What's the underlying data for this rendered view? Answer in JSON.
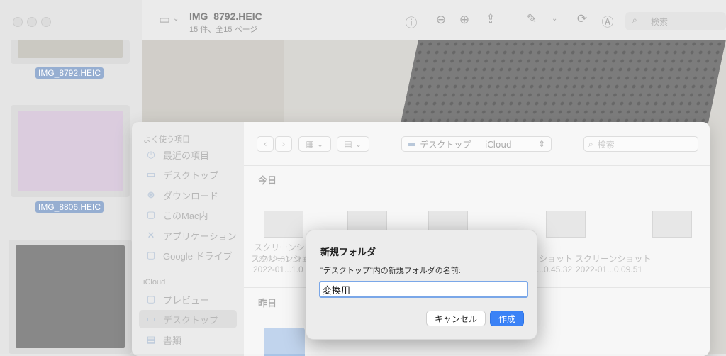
{
  "window": {
    "title": "IMG_8792.HEIC",
    "subtitle": "15 件、全15 ページ",
    "search_placeholder": "検索"
  },
  "sidebar": {
    "thumbnails": [
      {
        "label": "IMG_8792.HEIC"
      },
      {
        "label": "IMG_8806.HEIC"
      },
      {
        "label": ""
      }
    ]
  },
  "toolbar": {
    "icons": [
      "sidebar-icon",
      "info-icon",
      "zoom-out-icon",
      "zoom-in-icon",
      "share-icon",
      "markup-pen-icon",
      "rotate-icon",
      "annotate-icon",
      "search-icon"
    ]
  },
  "save_panel": {
    "favorites_header": "よく使う項目",
    "favorites": [
      {
        "label": "最近の項目",
        "icon": "clock-icon"
      },
      {
        "label": "デスクトップ",
        "icon": "desktop-icon"
      },
      {
        "label": "ダウンロード",
        "icon": "download-icon"
      },
      {
        "label": "このMac内",
        "icon": "folder-icon"
      },
      {
        "label": "アプリケーション",
        "icon": "applications-icon"
      },
      {
        "label": "Google ドライブ",
        "icon": "folder-icon"
      }
    ],
    "icloud_header": "iCloud",
    "icloud": [
      {
        "label": "プレビュー",
        "icon": "folder-icon"
      },
      {
        "label": "デスクトップ",
        "icon": "desktop-icon",
        "selected": true
      },
      {
        "label": "書類",
        "icon": "document-icon"
      }
    ],
    "location": "デスクトップ — iCloud",
    "search_placeholder": "検索",
    "today_label": "今日",
    "yesterday_label": "昨日",
    "files": [
      {
        "name": "スクリーンショ",
        "date": "2022-01...1.0"
      },
      {
        "name": "",
        "date": ""
      },
      {
        "name": "",
        "date": ""
      },
      {
        "name": "ショット",
        "date": "...0.45.32"
      },
      {
        "name": "スクリーンショット",
        "date": "2022-01...0.09.51"
      }
    ]
  },
  "dialog": {
    "title": "新規フォルダ",
    "prompt": "\"デスクトップ\"内の新規フォルダの名前:",
    "input_value": "変換用",
    "cancel_label": "キャンセル",
    "create_label": "作成"
  },
  "colors": {
    "accent": "#3b82f6",
    "focus_ring": "#7aa7e8",
    "selection_label": "#6e8fbf"
  }
}
